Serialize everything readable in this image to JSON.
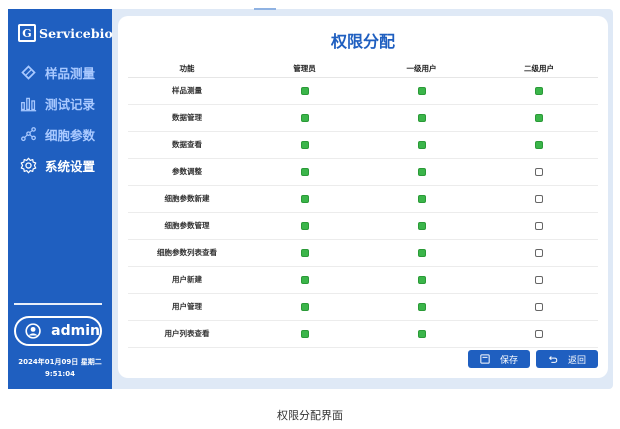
{
  "brand": {
    "logo_letter": "G",
    "name": "Servicebio"
  },
  "sidebar": {
    "items": [
      {
        "label": "样品测量",
        "icon": "diamond-icon",
        "active": false
      },
      {
        "label": "测试记录",
        "icon": "bar-chart-icon",
        "active": false
      },
      {
        "label": "细胞参数",
        "icon": "molecule-icon",
        "active": false
      },
      {
        "label": "系统设置",
        "icon": "gear-icon",
        "active": true
      }
    ],
    "user": "admin",
    "date": "2024年01月09日 星期二",
    "time": "9:51:04"
  },
  "main": {
    "title": "权限分配",
    "columns": [
      "功能",
      "管理员",
      "一级用户",
      "二级用户"
    ],
    "rows": [
      {
        "name": "样品测量",
        "perms": [
          true,
          true,
          true
        ]
      },
      {
        "name": "数据管理",
        "perms": [
          true,
          true,
          true
        ]
      },
      {
        "name": "数据查看",
        "perms": [
          true,
          true,
          true
        ]
      },
      {
        "name": "参数调整",
        "perms": [
          true,
          true,
          false
        ]
      },
      {
        "name": "细胞参数新建",
        "perms": [
          true,
          true,
          false
        ]
      },
      {
        "name": "细胞参数管理",
        "perms": [
          true,
          true,
          false
        ]
      },
      {
        "name": "细胞参数列表查看",
        "perms": [
          true,
          true,
          false
        ]
      },
      {
        "name": "用户新建",
        "perms": [
          true,
          true,
          false
        ]
      },
      {
        "name": "用户管理",
        "perms": [
          true,
          true,
          false
        ]
      },
      {
        "name": "用户列表查看",
        "perms": [
          true,
          true,
          false
        ]
      }
    ],
    "save_label": "保存",
    "back_label": "返回"
  },
  "caption": "权限分配界面",
  "colors": {
    "primary": "#1f5fc0",
    "granted": "#3bb54a"
  }
}
